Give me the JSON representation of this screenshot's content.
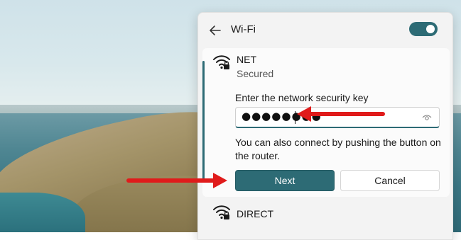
{
  "panel": {
    "title": "Wi-Fi",
    "toggle_on": true,
    "accent_color": "#2d6b75"
  },
  "selected_network": {
    "name": "NET",
    "status": "Secured",
    "icon": "wifi-secured-icon",
    "prompt": "Enter the network security key",
    "password_masked": "●●●●●●●●",
    "reveal_icon": "eye-icon",
    "hint": "You can also connect by pushing the button on the router.",
    "next_label": "Next",
    "cancel_label": "Cancel"
  },
  "other_networks": [
    {
      "name": "DIRECT",
      "icon": "wifi-secured-icon"
    }
  ],
  "annotation_color": "#e01b1b"
}
